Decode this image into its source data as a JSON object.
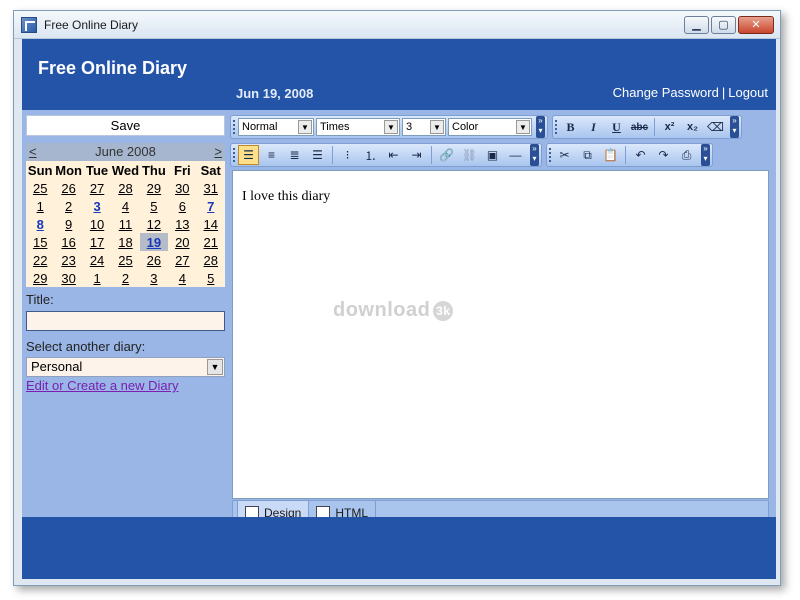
{
  "window": {
    "title": "Free Online Diary"
  },
  "header": {
    "app_name": "Free Online Diary",
    "date": "Jun 19, 2008",
    "change_password": "Change Password",
    "separator": "|",
    "logout": "Logout"
  },
  "sidebar": {
    "save_label": "Save",
    "calendar": {
      "prev": "<",
      "next": ">",
      "month": "June 2008",
      "days": [
        "Sun",
        "Mon",
        "Tue",
        "Wed",
        "Thu",
        "Fri",
        "Sat"
      ],
      "weeks": [
        [
          "25",
          "26",
          "27",
          "28",
          "29",
          "30",
          "31"
        ],
        [
          "1",
          "2",
          "3",
          "4",
          "5",
          "6",
          "7"
        ],
        [
          "8",
          "9",
          "10",
          "11",
          "12",
          "13",
          "14"
        ],
        [
          "15",
          "16",
          "17",
          "18",
          "19",
          "20",
          "21"
        ],
        [
          "22",
          "23",
          "24",
          "25",
          "26",
          "27",
          "28"
        ],
        [
          "29",
          "30",
          "1",
          "2",
          "3",
          "4",
          "5"
        ]
      ],
      "bold_dates": [
        "3",
        "7",
        "8"
      ],
      "selected": "19"
    },
    "title_label": "Title:",
    "title_value": "",
    "select_label": "Select another diary:",
    "select_value": "Personal",
    "edit_link": "Edit or Create a new Diary"
  },
  "toolbar": {
    "format": "Normal",
    "font": "Times",
    "size": "3",
    "color": "Color",
    "bold": "B",
    "italic": "I",
    "underline": "U",
    "strike": "abc",
    "superscript": "x²",
    "subscript": "x₂"
  },
  "editor": {
    "content": "I love this diary",
    "watermark": "download",
    "watermark_badge": "3k"
  },
  "tabs": [
    {
      "label": "Design"
    },
    {
      "label": "HTML"
    }
  ],
  "colors": {
    "header_blue": "#2454a8",
    "panel_blue": "#99b6e6",
    "calendar_bg": "#fff1da",
    "selected_day": "#1738b8",
    "link_purple": "#7a1fb0"
  }
}
